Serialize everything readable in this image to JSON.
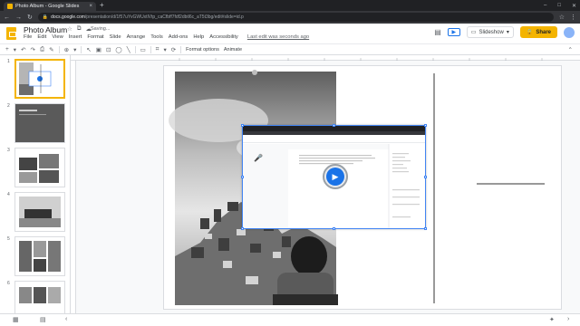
{
  "browser": {
    "tab_title": "Photo Album - Google Slides",
    "tab_close": "×",
    "new_tab": "+",
    "window_controls": [
      "–",
      "□",
      "✕"
    ],
    "url_host": "docs.google.com",
    "url_path": "/presentation/d/1f57uYvGWUxtlVtp_caCfbff7fdf2dbtl6c_aT5t3bg/edit#slide=id.p",
    "nav_icons": [
      "←",
      "→",
      "↻"
    ],
    "right_icons": [
      "☆",
      "⋮"
    ]
  },
  "header": {
    "doc_title": "Photo Album",
    "status": "Saving...",
    "menu": [
      "File",
      "Edit",
      "View",
      "Insert",
      "Format",
      "Slide",
      "Arrange",
      "Tools",
      "Add-ons",
      "Help",
      "Accessibility"
    ],
    "last_edit": "Last edit was seconds ago",
    "slideshow_label": "Slideshow",
    "share_label": "Share",
    "share_icon": "🔒"
  },
  "toolbar": {
    "format_options": "Format options",
    "animate": "Animate"
  },
  "filmstrip": {
    "slides": [
      "1",
      "2",
      "3",
      "4",
      "5",
      "6"
    ],
    "selected": 0
  },
  "colors": {
    "accent": "#f4b400",
    "selection": "#4285f4",
    "chrome_dark": "#202124"
  }
}
